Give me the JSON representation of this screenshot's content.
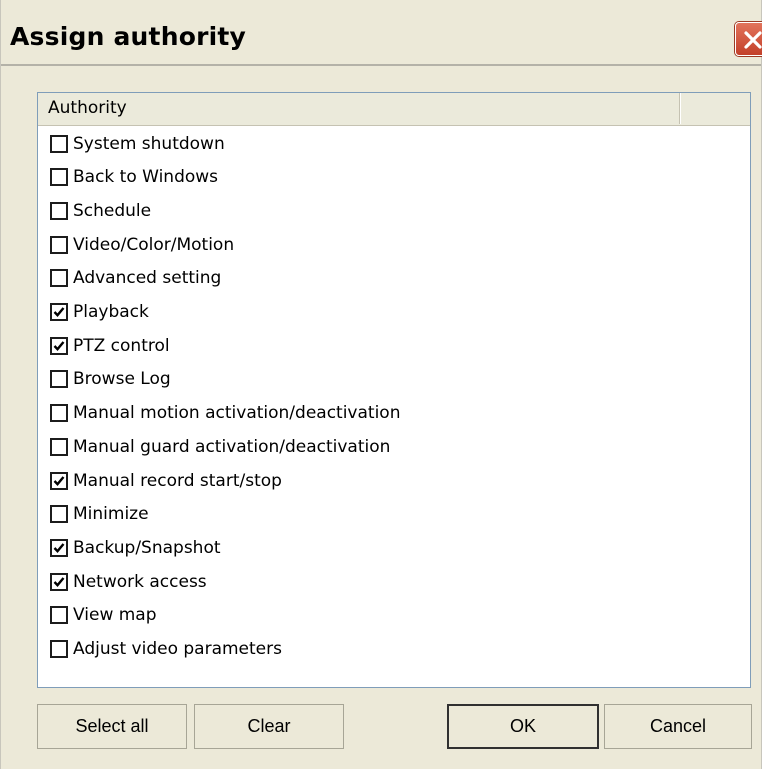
{
  "window": {
    "title": "Assign authority",
    "close_icon": "close-icon"
  },
  "list": {
    "header": {
      "column1": "Authority",
      "column2": ""
    },
    "items": [
      {
        "label": "System shutdown",
        "checked": false
      },
      {
        "label": "Back to Windows",
        "checked": false
      },
      {
        "label": "Schedule",
        "checked": false
      },
      {
        "label": "Video/Color/Motion",
        "checked": false
      },
      {
        "label": "Advanced setting",
        "checked": false
      },
      {
        "label": "Playback",
        "checked": true
      },
      {
        "label": "PTZ control",
        "checked": true
      },
      {
        "label": "Browse Log",
        "checked": false
      },
      {
        "label": "Manual motion activation/deactivation",
        "checked": false
      },
      {
        "label": "Manual guard activation/deactivation",
        "checked": false
      },
      {
        "label": "Manual record start/stop",
        "checked": true
      },
      {
        "label": "Minimize",
        "checked": false
      },
      {
        "label": "Backup/Snapshot",
        "checked": true
      },
      {
        "label": "Network access",
        "checked": true
      },
      {
        "label": "View map",
        "checked": false
      },
      {
        "label": "Adjust video parameters",
        "checked": false
      }
    ]
  },
  "buttons": {
    "select_all": "Select all",
    "clear": "Clear",
    "ok": "OK",
    "cancel": "Cancel"
  },
  "colors": {
    "dialog_bg": "#ece9d8",
    "close_button": "#c3402a",
    "list_border": "#7f9db9"
  }
}
